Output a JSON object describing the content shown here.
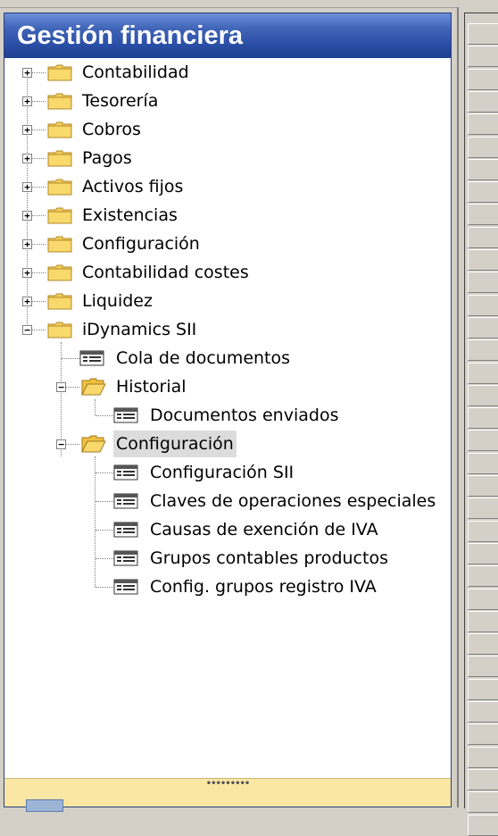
{
  "panel": {
    "title": "Gestión financiera"
  },
  "tree": {
    "top_items": [
      {
        "label": "Contabilidad",
        "expander": "+"
      },
      {
        "label": "Tesorería",
        "expander": "+"
      },
      {
        "label": "Cobros",
        "expander": "+"
      },
      {
        "label": "Pagos",
        "expander": "+"
      },
      {
        "label": "Activos fijos",
        "expander": "+"
      },
      {
        "label": "Existencias",
        "expander": "+"
      },
      {
        "label": "Configuración",
        "expander": "+"
      },
      {
        "label": "Contabilidad costes",
        "expander": "+"
      },
      {
        "label": "Liquidez",
        "expander": "+"
      },
      {
        "label": "iDynamics SII",
        "expander": "−"
      }
    ],
    "sii_children": {
      "cola": "Cola de documentos",
      "historial": {
        "label": "Historial",
        "expander": "−",
        "children": [
          "Documentos enviados"
        ]
      },
      "configuracion": {
        "label": "Configuración",
        "expander": "−",
        "selected": true,
        "children": [
          "Configuración SII",
          "Claves de operaciones especiales",
          "Causas de exención de IVA",
          "Grupos contables productos",
          "Config. grupos registro IVA"
        ]
      }
    }
  },
  "bottom_bar": {
    "grip": "•••••••••"
  },
  "colors": {
    "header_top": "#6b8fd8",
    "header_bottom": "#1f3f8f",
    "folder_fill": "#f7cf5a",
    "bottom_bar": "#fbe7a4",
    "selected_bg": "#dcdcdc"
  }
}
